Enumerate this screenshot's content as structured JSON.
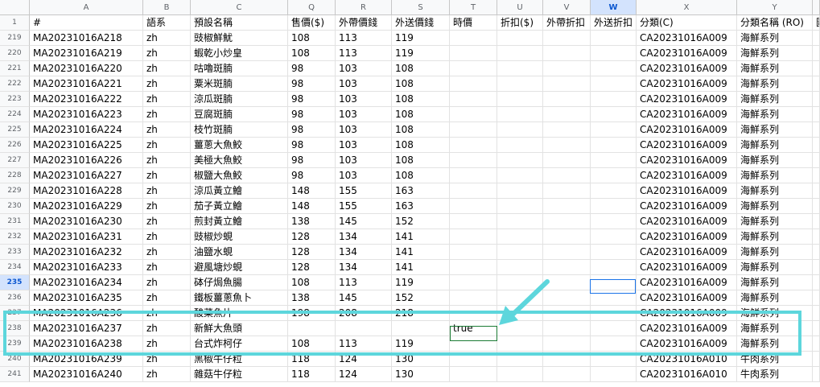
{
  "column_headers": [
    "",
    "A",
    "B",
    "C",
    "Q",
    "R",
    "S",
    "T",
    "U",
    "V",
    "W",
    "X",
    "Y",
    ""
  ],
  "header_row": {
    "num": "1",
    "cells": [
      "#",
      "語系",
      "預設名稱",
      "售價($)",
      "外帶價錢",
      "外送價錢",
      "時價",
      "折扣($)",
      "外帶折扣",
      "外送折扣",
      "分類(C)",
      "分類名稱 (RO)",
      "圖"
    ]
  },
  "rows": [
    {
      "num": "219",
      "id": "MA20231016A218",
      "lang": "zh",
      "name": "豉椒鮮魷",
      "price": "108",
      "takeout": "113",
      "delivery": "119",
      "market": "",
      "cat": "CA20231016A009",
      "catname": "海鮮系列"
    },
    {
      "num": "220",
      "id": "MA20231016A219",
      "lang": "zh",
      "name": "蝦乾小炒皇",
      "price": "108",
      "takeout": "113",
      "delivery": "119",
      "market": "",
      "cat": "CA20231016A009",
      "catname": "海鮮系列"
    },
    {
      "num": "221",
      "id": "MA20231016A220",
      "lang": "zh",
      "name": "咕嚕斑腩",
      "price": "98",
      "takeout": "103",
      "delivery": "108",
      "market": "",
      "cat": "CA20231016A009",
      "catname": "海鮮系列"
    },
    {
      "num": "222",
      "id": "MA20231016A221",
      "lang": "zh",
      "name": "粟米斑腩",
      "price": "98",
      "takeout": "103",
      "delivery": "108",
      "market": "",
      "cat": "CA20231016A009",
      "catname": "海鮮系列"
    },
    {
      "num": "223",
      "id": "MA20231016A222",
      "lang": "zh",
      "name": "涼瓜斑腩",
      "price": "98",
      "takeout": "103",
      "delivery": "108",
      "market": "",
      "cat": "CA20231016A009",
      "catname": "海鮮系列"
    },
    {
      "num": "224",
      "id": "MA20231016A223",
      "lang": "zh",
      "name": "豆腐斑腩",
      "price": "98",
      "takeout": "103",
      "delivery": "108",
      "market": "",
      "cat": "CA20231016A009",
      "catname": "海鮮系列"
    },
    {
      "num": "225",
      "id": "MA20231016A224",
      "lang": "zh",
      "name": "枝竹斑腩",
      "price": "98",
      "takeout": "103",
      "delivery": "108",
      "market": "",
      "cat": "CA20231016A009",
      "catname": "海鮮系列"
    },
    {
      "num": "226",
      "id": "MA20231016A225",
      "lang": "zh",
      "name": "薑蔥大魚鮫",
      "price": "98",
      "takeout": "103",
      "delivery": "108",
      "market": "",
      "cat": "CA20231016A009",
      "catname": "海鮮系列"
    },
    {
      "num": "227",
      "id": "MA20231016A226",
      "lang": "zh",
      "name": "美極大魚鮫",
      "price": "98",
      "takeout": "103",
      "delivery": "108",
      "market": "",
      "cat": "CA20231016A009",
      "catname": "海鮮系列"
    },
    {
      "num": "228",
      "id": "MA20231016A227",
      "lang": "zh",
      "name": "椒鹽大魚鮫",
      "price": "98",
      "takeout": "103",
      "delivery": "108",
      "market": "",
      "cat": "CA20231016A009",
      "catname": "海鮮系列"
    },
    {
      "num": "229",
      "id": "MA20231016A228",
      "lang": "zh",
      "name": "涼瓜黃立鱠",
      "price": "148",
      "takeout": "155",
      "delivery": "163",
      "market": "",
      "cat": "CA20231016A009",
      "catname": "海鮮系列"
    },
    {
      "num": "230",
      "id": "MA20231016A229",
      "lang": "zh",
      "name": "茄子黃立鱠",
      "price": "148",
      "takeout": "155",
      "delivery": "163",
      "market": "",
      "cat": "CA20231016A009",
      "catname": "海鮮系列"
    },
    {
      "num": "231",
      "id": "MA20231016A230",
      "lang": "zh",
      "name": "煎封黃立鱠",
      "price": "138",
      "takeout": "145",
      "delivery": "152",
      "market": "",
      "cat": "CA20231016A009",
      "catname": "海鮮系列"
    },
    {
      "num": "232",
      "id": "MA20231016A231",
      "lang": "zh",
      "name": "豉椒炒蜆",
      "price": "128",
      "takeout": "134",
      "delivery": "141",
      "market": "",
      "cat": "CA20231016A009",
      "catname": "海鮮系列"
    },
    {
      "num": "233",
      "id": "MA20231016A232",
      "lang": "zh",
      "name": "油鹽水蜆",
      "price": "128",
      "takeout": "134",
      "delivery": "141",
      "market": "",
      "cat": "CA20231016A009",
      "catname": "海鮮系列"
    },
    {
      "num": "234",
      "id": "MA20231016A233",
      "lang": "zh",
      "name": "避風塘炒蜆",
      "price": "128",
      "takeout": "134",
      "delivery": "141",
      "market": "",
      "cat": "CA20231016A009",
      "catname": "海鮮系列"
    },
    {
      "num": "235",
      "id": "MA20231016A234",
      "lang": "zh",
      "name": "砵仔焗魚腸",
      "price": "108",
      "takeout": "113",
      "delivery": "119",
      "market": "",
      "cat": "CA20231016A009",
      "catname": "海鮮系列"
    },
    {
      "num": "236",
      "id": "MA20231016A235",
      "lang": "zh",
      "name": "鐵板薑蔥魚卜",
      "price": "138",
      "takeout": "145",
      "delivery": "152",
      "market": "",
      "cat": "CA20231016A009",
      "catname": "海鮮系列"
    },
    {
      "num": "237",
      "id": "MA20231016A236",
      "lang": "zh",
      "name": "酸菜魚片",
      "price": "198",
      "takeout": "208",
      "delivery": "218",
      "market": "",
      "cat": "CA20231016A009",
      "catname": "海鮮系列"
    },
    {
      "num": "238",
      "id": "MA20231016A237",
      "lang": "zh",
      "name": "新鮮大魚頭",
      "price": "",
      "takeout": "",
      "delivery": "",
      "market": "true",
      "cat": "CA20231016A009",
      "catname": "海鮮系列"
    },
    {
      "num": "239",
      "id": "MA20231016A238",
      "lang": "zh",
      "name": "台式炸柯仔",
      "price": "108",
      "takeout": "113",
      "delivery": "119",
      "market": "",
      "cat": "CA20231016A009",
      "catname": "海鮮系列"
    },
    {
      "num": "240",
      "id": "MA20231016A239",
      "lang": "zh",
      "name": "黑椒牛仔粒",
      "price": "118",
      "takeout": "124",
      "delivery": "130",
      "market": "",
      "cat": "CA20231016A010",
      "catname": "牛肉系列"
    },
    {
      "num": "241",
      "id": "MA20231016A240",
      "lang": "zh",
      "name": "雜菇牛仔粒",
      "price": "118",
      "takeout": "124",
      "delivery": "130",
      "market": "",
      "cat": "CA20231016A010",
      "catname": "牛肉系列"
    }
  ],
  "selected_column": "W",
  "selected_row": "235",
  "colors": {
    "highlight_box": "#5dd6dc",
    "arrow": "#5dd6dc",
    "selection": "#1a73e8"
  }
}
